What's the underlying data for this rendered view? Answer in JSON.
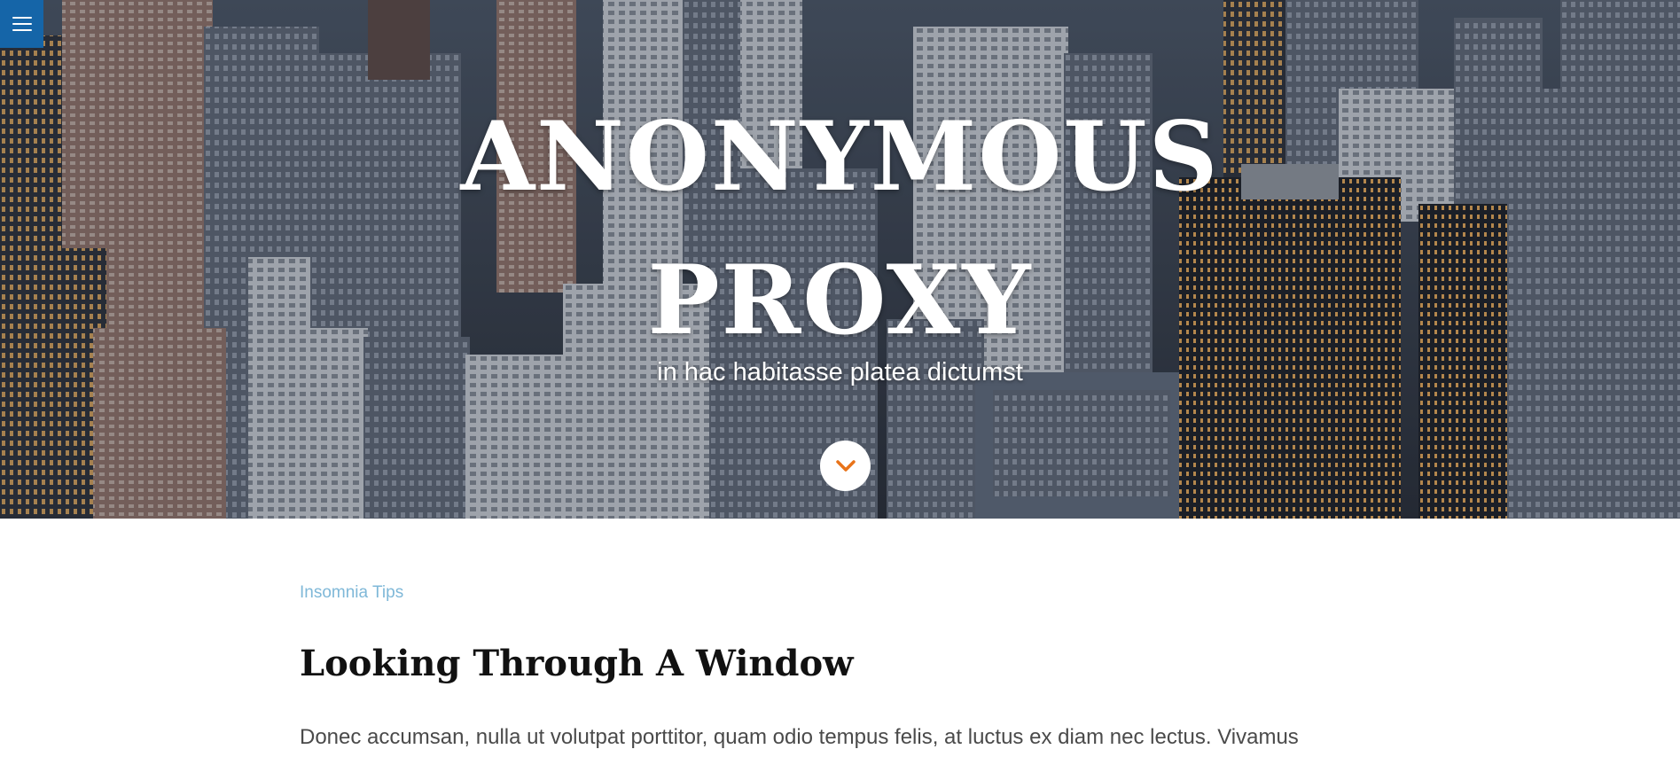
{
  "menu": {
    "icon": "hamburger-menu-icon"
  },
  "hero": {
    "title_line1": "ANONYMOUS",
    "title_line2": "PROXY",
    "subtitle": "in hac habitasse platea dictumst",
    "scroll_icon": "chevron-down-icon",
    "background": "city-skyline-photo"
  },
  "post": {
    "category": "Insomnia Tips",
    "title": "Looking Through A Window",
    "excerpt": "Donec accumsan, nulla ut volutpat porttitor, quam odio tempus felis, at luctus ex diam nec lectus. Vivamus"
  },
  "colors": {
    "menu_bg": "#1565a8",
    "accent_chevron": "#e8731a",
    "category_link": "#7fb8d8"
  }
}
